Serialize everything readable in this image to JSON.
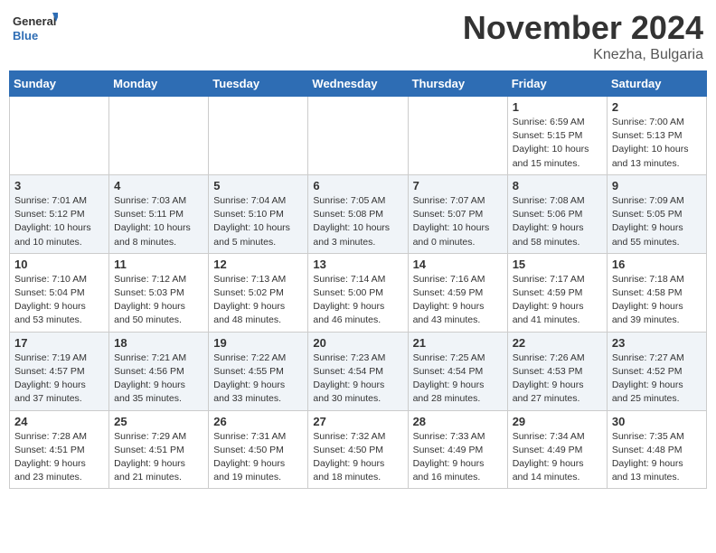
{
  "header": {
    "logo_line1": "General",
    "logo_line2": "Blue",
    "month_year": "November 2024",
    "location": "Knezha, Bulgaria"
  },
  "days_of_week": [
    "Sunday",
    "Monday",
    "Tuesday",
    "Wednesday",
    "Thursday",
    "Friday",
    "Saturday"
  ],
  "weeks": [
    [
      {
        "day": "",
        "info": ""
      },
      {
        "day": "",
        "info": ""
      },
      {
        "day": "",
        "info": ""
      },
      {
        "day": "",
        "info": ""
      },
      {
        "day": "",
        "info": ""
      },
      {
        "day": "1",
        "info": "Sunrise: 6:59 AM\nSunset: 5:15 PM\nDaylight: 10 hours and 15 minutes."
      },
      {
        "day": "2",
        "info": "Sunrise: 7:00 AM\nSunset: 5:13 PM\nDaylight: 10 hours and 13 minutes."
      }
    ],
    [
      {
        "day": "3",
        "info": "Sunrise: 7:01 AM\nSunset: 5:12 PM\nDaylight: 10 hours and 10 minutes."
      },
      {
        "day": "4",
        "info": "Sunrise: 7:03 AM\nSunset: 5:11 PM\nDaylight: 10 hours and 8 minutes."
      },
      {
        "day": "5",
        "info": "Sunrise: 7:04 AM\nSunset: 5:10 PM\nDaylight: 10 hours and 5 minutes."
      },
      {
        "day": "6",
        "info": "Sunrise: 7:05 AM\nSunset: 5:08 PM\nDaylight: 10 hours and 3 minutes."
      },
      {
        "day": "7",
        "info": "Sunrise: 7:07 AM\nSunset: 5:07 PM\nDaylight: 10 hours and 0 minutes."
      },
      {
        "day": "8",
        "info": "Sunrise: 7:08 AM\nSunset: 5:06 PM\nDaylight: 9 hours and 58 minutes."
      },
      {
        "day": "9",
        "info": "Sunrise: 7:09 AM\nSunset: 5:05 PM\nDaylight: 9 hours and 55 minutes."
      }
    ],
    [
      {
        "day": "10",
        "info": "Sunrise: 7:10 AM\nSunset: 5:04 PM\nDaylight: 9 hours and 53 minutes."
      },
      {
        "day": "11",
        "info": "Sunrise: 7:12 AM\nSunset: 5:03 PM\nDaylight: 9 hours and 50 minutes."
      },
      {
        "day": "12",
        "info": "Sunrise: 7:13 AM\nSunset: 5:02 PM\nDaylight: 9 hours and 48 minutes."
      },
      {
        "day": "13",
        "info": "Sunrise: 7:14 AM\nSunset: 5:00 PM\nDaylight: 9 hours and 46 minutes."
      },
      {
        "day": "14",
        "info": "Sunrise: 7:16 AM\nSunset: 4:59 PM\nDaylight: 9 hours and 43 minutes."
      },
      {
        "day": "15",
        "info": "Sunrise: 7:17 AM\nSunset: 4:59 PM\nDaylight: 9 hours and 41 minutes."
      },
      {
        "day": "16",
        "info": "Sunrise: 7:18 AM\nSunset: 4:58 PM\nDaylight: 9 hours and 39 minutes."
      }
    ],
    [
      {
        "day": "17",
        "info": "Sunrise: 7:19 AM\nSunset: 4:57 PM\nDaylight: 9 hours and 37 minutes."
      },
      {
        "day": "18",
        "info": "Sunrise: 7:21 AM\nSunset: 4:56 PM\nDaylight: 9 hours and 35 minutes."
      },
      {
        "day": "19",
        "info": "Sunrise: 7:22 AM\nSunset: 4:55 PM\nDaylight: 9 hours and 33 minutes."
      },
      {
        "day": "20",
        "info": "Sunrise: 7:23 AM\nSunset: 4:54 PM\nDaylight: 9 hours and 30 minutes."
      },
      {
        "day": "21",
        "info": "Sunrise: 7:25 AM\nSunset: 4:54 PM\nDaylight: 9 hours and 28 minutes."
      },
      {
        "day": "22",
        "info": "Sunrise: 7:26 AM\nSunset: 4:53 PM\nDaylight: 9 hours and 27 minutes."
      },
      {
        "day": "23",
        "info": "Sunrise: 7:27 AM\nSunset: 4:52 PM\nDaylight: 9 hours and 25 minutes."
      }
    ],
    [
      {
        "day": "24",
        "info": "Sunrise: 7:28 AM\nSunset: 4:51 PM\nDaylight: 9 hours and 23 minutes."
      },
      {
        "day": "25",
        "info": "Sunrise: 7:29 AM\nSunset: 4:51 PM\nDaylight: 9 hours and 21 minutes."
      },
      {
        "day": "26",
        "info": "Sunrise: 7:31 AM\nSunset: 4:50 PM\nDaylight: 9 hours and 19 minutes."
      },
      {
        "day": "27",
        "info": "Sunrise: 7:32 AM\nSunset: 4:50 PM\nDaylight: 9 hours and 18 minutes."
      },
      {
        "day": "28",
        "info": "Sunrise: 7:33 AM\nSunset: 4:49 PM\nDaylight: 9 hours and 16 minutes."
      },
      {
        "day": "29",
        "info": "Sunrise: 7:34 AM\nSunset: 4:49 PM\nDaylight: 9 hours and 14 minutes."
      },
      {
        "day": "30",
        "info": "Sunrise: 7:35 AM\nSunset: 4:48 PM\nDaylight: 9 hours and 13 minutes."
      }
    ]
  ]
}
